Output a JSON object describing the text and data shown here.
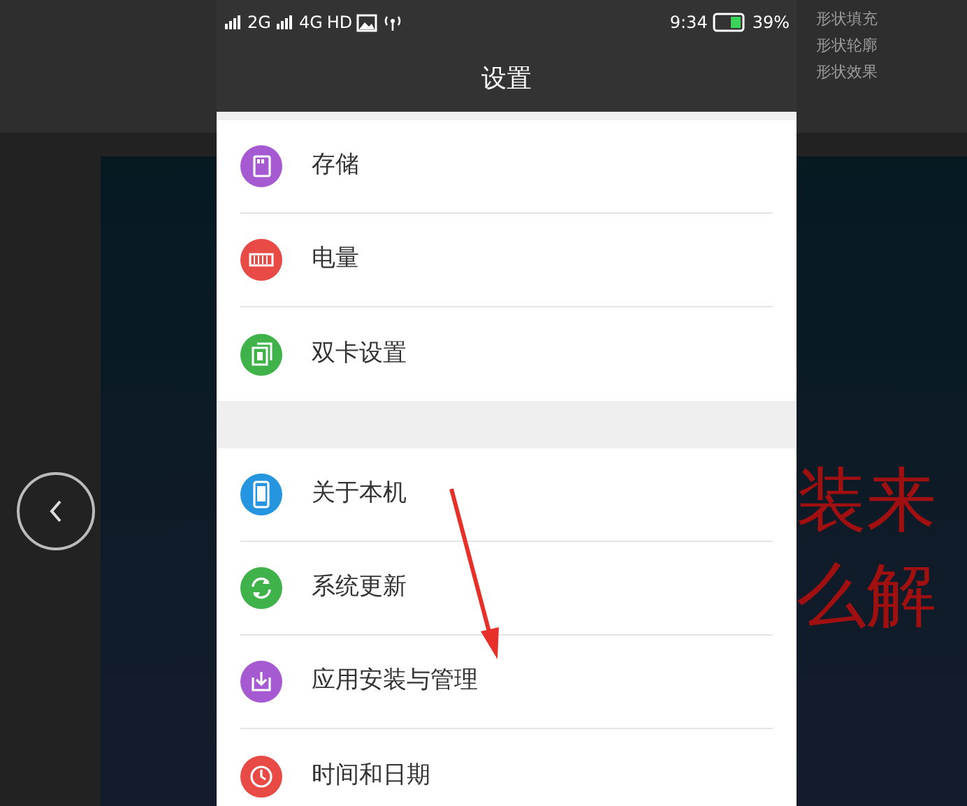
{
  "ribbon": {
    "items": [
      "形状填充",
      "形状轮廓",
      "形状效果"
    ]
  },
  "slide": {
    "texts": [
      "装来",
      "么解"
    ]
  },
  "phone": {
    "status_bar": {
      "network_1": "2G",
      "network_2": "4G",
      "hd": "HD",
      "time": "9:34",
      "battery": "39%"
    },
    "title": "设置",
    "groups": [
      [
        {
          "label": "存储",
          "kind": "storage",
          "color": "#a65ad1"
        },
        {
          "label": "电量",
          "kind": "battery",
          "color": "#e84a45"
        },
        {
          "label": "双卡设置",
          "kind": "sim",
          "color": "#3fb34a"
        }
      ],
      [
        {
          "label": "关于本机",
          "kind": "phone",
          "color": "#2595e0"
        },
        {
          "label": "系统更新",
          "kind": "update",
          "color": "#3fb34a"
        },
        {
          "label": "应用安装与管理",
          "kind": "install",
          "color": "#a65ad1"
        },
        {
          "label": "时间和日期",
          "kind": "clock",
          "color": "#e84a45"
        }
      ]
    ]
  }
}
